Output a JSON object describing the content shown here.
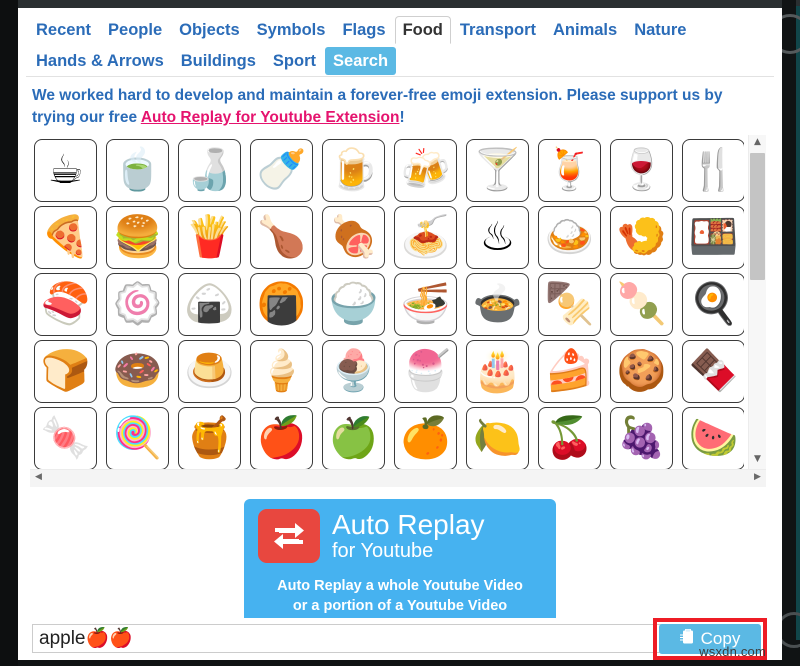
{
  "tabs": {
    "row1": [
      {
        "label": "Recent",
        "state": "normal"
      },
      {
        "label": "People",
        "state": "normal"
      },
      {
        "label": "Objects",
        "state": "normal"
      },
      {
        "label": "Symbols",
        "state": "normal"
      },
      {
        "label": "Flags",
        "state": "normal"
      },
      {
        "label": "Food",
        "state": "active"
      },
      {
        "label": "Transport",
        "state": "normal"
      },
      {
        "label": "Animals",
        "state": "normal"
      },
      {
        "label": "Nature",
        "state": "normal"
      }
    ],
    "row2": [
      {
        "label": "Hands & Arrows",
        "state": "normal"
      },
      {
        "label": "Buildings",
        "state": "normal"
      },
      {
        "label": "Sport",
        "state": "normal"
      },
      {
        "label": "Search",
        "state": "selected"
      }
    ],
    "active_tab": "Food",
    "selected_tab": "Search"
  },
  "promo": {
    "text_before": "We worked hard to develop and maintain a forever-free emoji extension. Please support us by trying our free ",
    "link": "Auto Replay for Youtube Extension",
    "text_after": "!"
  },
  "grid": {
    "rows": [
      [
        {
          "glyph": "☕",
          "name": "hot-beverage"
        },
        {
          "glyph": "🍵",
          "name": "teacup-without-handle"
        },
        {
          "glyph": "🍶",
          "name": "sake"
        },
        {
          "glyph": "🍼",
          "name": "baby-bottle"
        },
        {
          "glyph": "🍺",
          "name": "beer-mug"
        },
        {
          "glyph": "🍻",
          "name": "clinking-beer-mugs"
        },
        {
          "glyph": "🍸",
          "name": "cocktail-glass"
        },
        {
          "glyph": "🍹",
          "name": "tropical-drink"
        },
        {
          "glyph": "🍷",
          "name": "wine-glass"
        },
        {
          "glyph": "🍴",
          "name": "fork-and-knife"
        }
      ],
      [
        {
          "glyph": "🍕",
          "name": "pizza"
        },
        {
          "glyph": "🍔",
          "name": "hamburger"
        },
        {
          "glyph": "🍟",
          "name": "french-fries"
        },
        {
          "glyph": "🍗",
          "name": "poultry-leg"
        },
        {
          "glyph": "🍖",
          "name": "meat-on-bone"
        },
        {
          "glyph": "🍝",
          "name": "spaghetti"
        },
        {
          "glyph": "♨",
          "name": "hot-springs"
        },
        {
          "glyph": "🍛",
          "name": "curry-rice"
        },
        {
          "glyph": "🍤",
          "name": "fried-shrimp"
        },
        {
          "glyph": "🍱",
          "name": "bento-box"
        }
      ],
      [
        {
          "glyph": "🍣",
          "name": "sushi"
        },
        {
          "glyph": "🍥",
          "name": "fish-cake"
        },
        {
          "glyph": "🍙",
          "name": "rice-ball"
        },
        {
          "glyph": "🍘",
          "name": "rice-cracker"
        },
        {
          "glyph": "🍚",
          "name": "cooked-rice"
        },
        {
          "glyph": "🍜",
          "name": "steaming-bowl"
        },
        {
          "glyph": "🍲",
          "name": "pot-of-food"
        },
        {
          "glyph": "🍢",
          "name": "oden"
        },
        {
          "glyph": "🍡",
          "name": "dango"
        },
        {
          "glyph": "🍳",
          "name": "cooking-fried-egg"
        }
      ],
      [
        {
          "glyph": "🍞",
          "name": "bread"
        },
        {
          "glyph": "🍩",
          "name": "doughnut"
        },
        {
          "glyph": "🍮",
          "name": "custard"
        },
        {
          "glyph": "🍦",
          "name": "soft-ice-cream"
        },
        {
          "glyph": "🍨",
          "name": "ice-cream-sundae"
        },
        {
          "glyph": "🍧",
          "name": "shaved-ice"
        },
        {
          "glyph": "🎂",
          "name": "birthday-cake"
        },
        {
          "glyph": "🍰",
          "name": "shortcake"
        },
        {
          "glyph": "🍪",
          "name": "cookie"
        },
        {
          "glyph": "🍫",
          "name": "chocolate-bar"
        }
      ],
      [
        {
          "glyph": "🍬",
          "name": "candy"
        },
        {
          "glyph": "🍭",
          "name": "lollipop"
        },
        {
          "glyph": "🍯",
          "name": "honey-pot"
        },
        {
          "glyph": "🍎",
          "name": "red-apple"
        },
        {
          "glyph": "🍏",
          "name": "green-apple"
        },
        {
          "glyph": "🍊",
          "name": "tangerine"
        },
        {
          "glyph": "🍋",
          "name": "lemon"
        },
        {
          "glyph": "🍒",
          "name": "cherries"
        },
        {
          "glyph": "🍇",
          "name": "grapes"
        },
        {
          "glyph": "🍉",
          "name": "watermelon"
        }
      ]
    ]
  },
  "scrollbars": {
    "up_arrow": "▲",
    "down_arrow": "▼",
    "left_arrow": "◀",
    "right_arrow": "▶"
  },
  "banner": {
    "title": "Auto Replay",
    "subtitle": "for Youtube",
    "logo_glyph": "↺",
    "line1": "Auto Replay a whole Youtube Video",
    "line2": "or a portion of a Youtube Video",
    "bg_color": "#46b2f0",
    "logo_color": "#e8473f"
  },
  "bottom": {
    "input_value": "apple🍎🍎",
    "input_placeholder": "",
    "copy_label": "Copy",
    "copy_icon": "clipboard-icon",
    "highlight_color": "#ee1c25",
    "copy_color": "#5bb9e4"
  },
  "watermark": "wsxdn.com"
}
